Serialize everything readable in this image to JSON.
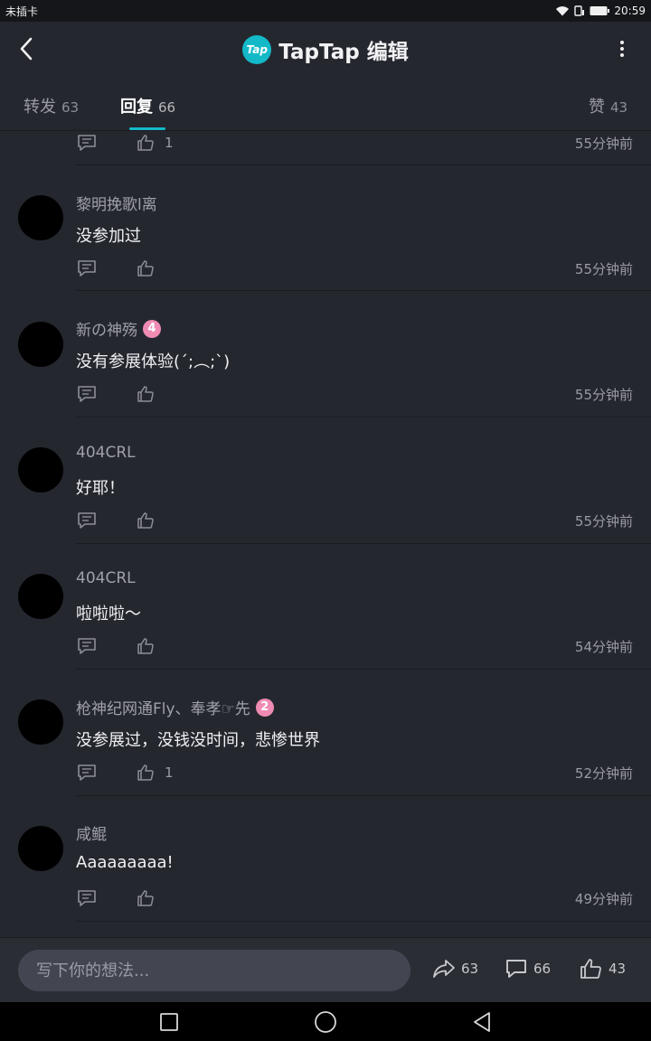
{
  "status_bar": {
    "carrier": "未插卡",
    "time": "20:59"
  },
  "header": {
    "logo_text": "Tap",
    "title": "TapTap 编辑"
  },
  "tabs": [
    {
      "label": "转发",
      "count": "63"
    },
    {
      "label": "回复",
      "count": "66"
    },
    {
      "label": "赞",
      "count": "43"
    }
  ],
  "comments": [
    {
      "user": "",
      "badge": "",
      "content": "",
      "likes": "1",
      "time": "55分钟前"
    },
    {
      "user": "黎明挽歌l离",
      "badge": "",
      "content": "没参加过",
      "likes": "",
      "time": "55分钟前"
    },
    {
      "user": "新の神殇",
      "badge": "4",
      "content": "没有参展体验(´;︵;`)",
      "likes": "",
      "time": "55分钟前"
    },
    {
      "user": "404CRL",
      "badge": "",
      "content": "好耶！",
      "likes": "",
      "time": "55分钟前"
    },
    {
      "user": "404CRL",
      "badge": "",
      "content": "啦啦啦～",
      "likes": "",
      "time": "54分钟前"
    },
    {
      "user": "枪神纪网通Fly、奉孝☞先",
      "badge": "2",
      "content": "没参展过，没钱没时间，悲惨世界",
      "likes": "1",
      "time": "52分钟前"
    },
    {
      "user": "咸鲲",
      "badge": "",
      "content": "Aaaaaaaaa!",
      "likes": "",
      "time": "49分钟前"
    }
  ],
  "bottom_bar": {
    "placeholder": "写下你的想法...",
    "repost_count": "63",
    "comment_count": "66",
    "like_count": "43"
  },
  "colors": {
    "accent": "#14b9c8",
    "background": "#25272f",
    "badge": "#f08bb4"
  }
}
